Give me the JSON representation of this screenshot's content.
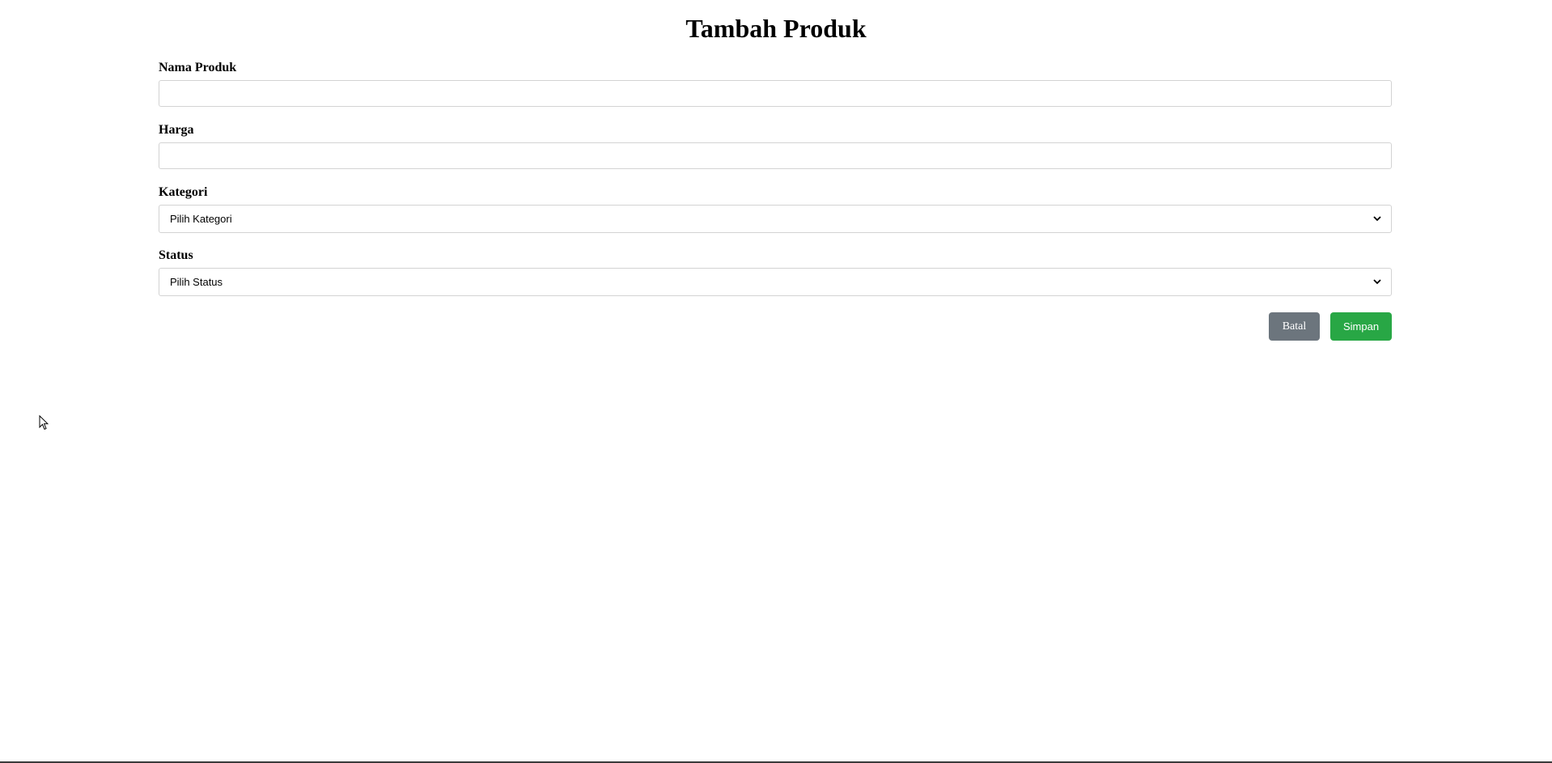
{
  "page": {
    "title": "Tambah Produk"
  },
  "form": {
    "fields": [
      {
        "label": "Nama Produk",
        "value": "",
        "placeholder": ""
      },
      {
        "label": "Harga",
        "value": "",
        "placeholder": ""
      }
    ],
    "selects": [
      {
        "label": "Kategori",
        "selected": "Pilih Kategori"
      },
      {
        "label": "Status",
        "selected": "Pilih Status"
      }
    ]
  },
  "actions": {
    "cancel_label": "Batal",
    "save_label": "Simpan"
  },
  "colors": {
    "cancel_button": "#6c757d",
    "save_button": "#28a745",
    "input_border": "#d3d3d3"
  },
  "icons": {
    "select_arrow": "chevron-down-icon",
    "pointer": "mouse-cursor-icon"
  }
}
